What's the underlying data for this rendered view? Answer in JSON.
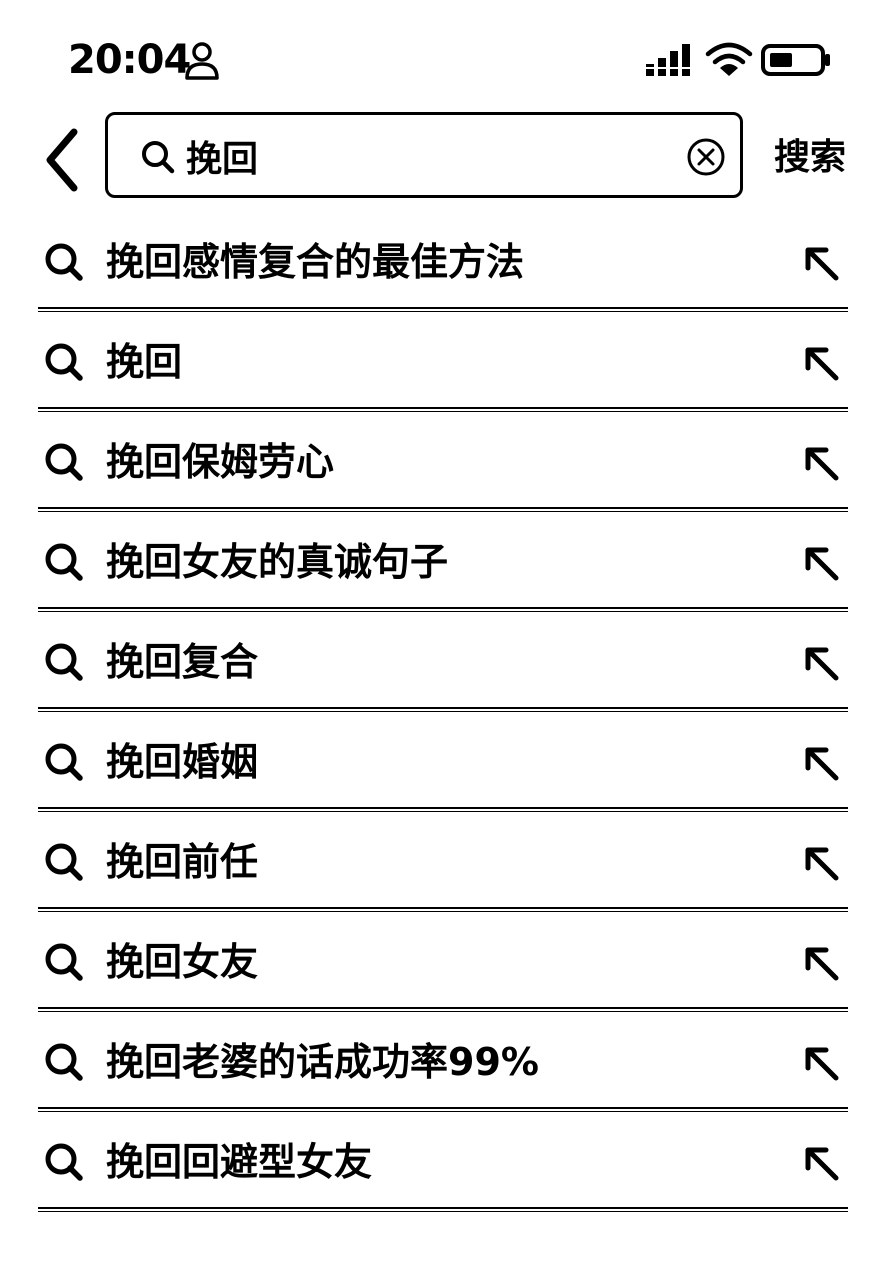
{
  "status_bar": {
    "time": "20:04",
    "icons": [
      "person-icon",
      "signal-icon",
      "wifi-icon",
      "battery-icon"
    ]
  },
  "search": {
    "back_icon": "chevron-left-icon",
    "query": "挽回",
    "clear_icon": "clear-circle-icon",
    "submit_label": "搜索"
  },
  "suggestions": [
    {
      "text": "挽回感情复合的最佳方法"
    },
    {
      "text": "挽回"
    },
    {
      "text": "挽回保姆劳心"
    },
    {
      "text": "挽回女友的真诚句子"
    },
    {
      "text": "挽回复合"
    },
    {
      "text": "挽回婚姻"
    },
    {
      "text": "挽回前任"
    },
    {
      "text": "挽回女友"
    },
    {
      "text": "挽回老婆的话成功率99%"
    },
    {
      "text": "挽回回避型女友"
    }
  ],
  "colors": {
    "text": "#000000",
    "background": "#ffffff"
  }
}
